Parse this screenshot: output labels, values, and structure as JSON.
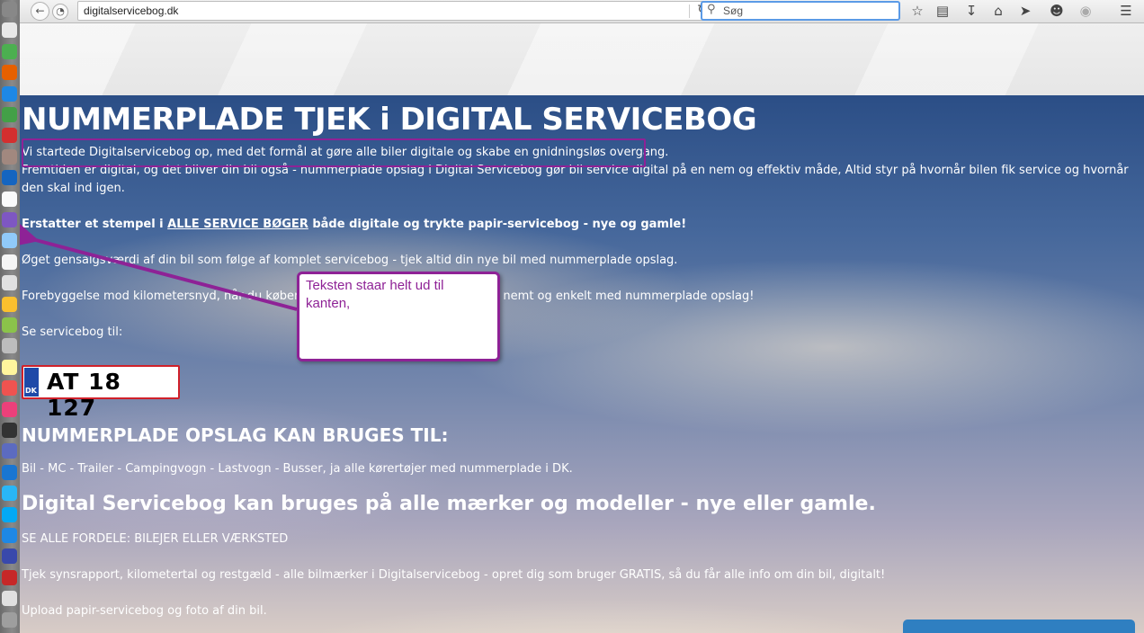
{
  "browser": {
    "url": "digitalservicebog.dk",
    "search_placeholder": "Søg"
  },
  "dock_icons": [
    "system-preferences-icon",
    "calendar-icon",
    "kilometer-app-icon",
    "firefox-icon",
    "safari-icon",
    "chrome-icon",
    "opera-icon",
    "finder-folder-icon",
    "migration-icon",
    "text-editor-icon",
    "photos-icon",
    "downloads-icon",
    "preview-icon",
    "script-editor-icon",
    "cyberduck-icon",
    "android-icon",
    "mail-icon",
    "notes-icon",
    "photo-booth-icon",
    "itunes-icon",
    "terminal-icon",
    "launchpad-icon",
    "network-icon",
    "wifi-icon",
    "skype-icon",
    "teamviewer-icon",
    "google-earth-icon",
    "acrobat-icon",
    "printer-icon",
    "trash-icon"
  ],
  "page": {
    "title": "NUMMERPLADE TJEK i DIGITAL SERVICEBOG",
    "intro": "Vi startede Digitalservicebog op, med det formål at gøre alle biler digitale og skabe en gnidningsløs overgang.",
    "line2": "Fremtiden er digital, og det bliver din bil også - nummerplade opslag i Digital Servicebog gør bil service digital på en nem og effektiv måde, Altid styr på hvornår bilen fik service og hvornår den skal ind igen.",
    "bold_pre": "Erstatter et stempel i ",
    "bold_link": "ALLE SERVICE BØGER",
    "bold_post": " både digitale og trykte papir-servicebog - nye og gamle!",
    "line_resale": "Øget gensalgsværdi af din bil som følge af komplet servicebog - tjek altid din nye bil med nummerplade opslag.",
    "line_prevention": "Forebyggelse mod kilometersnyd, når du køber en brugt bil, tjek kilometerstand - nemt og enkelt med nummerplade opslag!",
    "see_servicebook": "Se servicebog til:",
    "plate_country": "DK",
    "plate_number": "AT 18 127",
    "h2_uses": "NUMMERPLADE OPSLAG KAN BRUGES TIL:",
    "vehicles": "Bil - MC - Trailer - Campingvogn - Lastvogn - Busser, ja alle kørertøjer med nummerplade i DK.",
    "h2_brands": "Digital Servicebog kan bruges på alle mærker og modeller - nye eller gamle.",
    "see_benefits": "SE ALLE FORDELE: BILEJER ELLER VÆRKSTED",
    "inspection": "Tjek synsrapport, kilometertal og restgæld - alle bilmærker i Digitalservicebog - opret dig som bruger GRATIS, så du får alle info om din bil, digitalt!",
    "upload": "Upload papir-servicebog og foto af din bil."
  },
  "annotation": {
    "callout_text": "Teksten staar helt ud til kanten,",
    "color": "#8e2296"
  }
}
